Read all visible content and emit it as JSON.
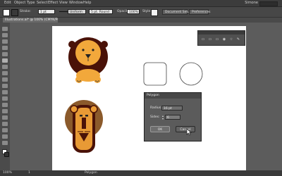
{
  "menubar": {
    "items": [
      {
        "label": "Edit"
      },
      {
        "label": "Object"
      },
      {
        "label": "Type"
      },
      {
        "label": "Select"
      },
      {
        "label": "Effect"
      },
      {
        "label": "View"
      },
      {
        "label": "Window"
      },
      {
        "label": "Help"
      }
    ],
    "workspace": "Simone"
  },
  "control_bar": {
    "stroke_label": "Stroke:",
    "stroke_weight": "1 pt",
    "stroke_profile": "Uniform",
    "brush": "5 pt. Round",
    "opacity_label": "Opacity:",
    "opacity_value": "100%",
    "style_label": "Style:",
    "document_setup": "Document Setup",
    "preferences": "Preferences",
    "colors": {
      "fill": "#ffffff",
      "stroke": "#222222"
    }
  },
  "document_tab": {
    "label": "Illustrations.ai* @ 100% (CMYK/Preview)"
  },
  "status_bar": {
    "zoom": "100%",
    "page": "1",
    "tool": "Polygon"
  },
  "panel": {
    "icons": [
      {
        "name": "align-icon",
        "glyph": "▭"
      },
      {
        "name": "transform-icon",
        "glyph": "▭"
      },
      {
        "name": "pathfinder-icon",
        "glyph": "▭"
      },
      {
        "name": "appearance-icon",
        "glyph": "◉"
      },
      {
        "name": "symbols-icon",
        "glyph": "☆"
      },
      {
        "name": "brushes-icon",
        "glyph": "✎"
      }
    ]
  },
  "polygon_dialog": {
    "title": "Polygon",
    "radius_label": "Radius:",
    "radius_value": "16 pt",
    "sides_label": "Sides:",
    "sides_value": "6",
    "ok_label": "OK",
    "cancel_label": "Cancel"
  },
  "colors": {
    "mane_dark": "#4a1208",
    "lion_face": "#f2a83b",
    "mane_brown": "#8b5a2b",
    "lion_gold": "#e89a35",
    "outline": "#333333"
  }
}
